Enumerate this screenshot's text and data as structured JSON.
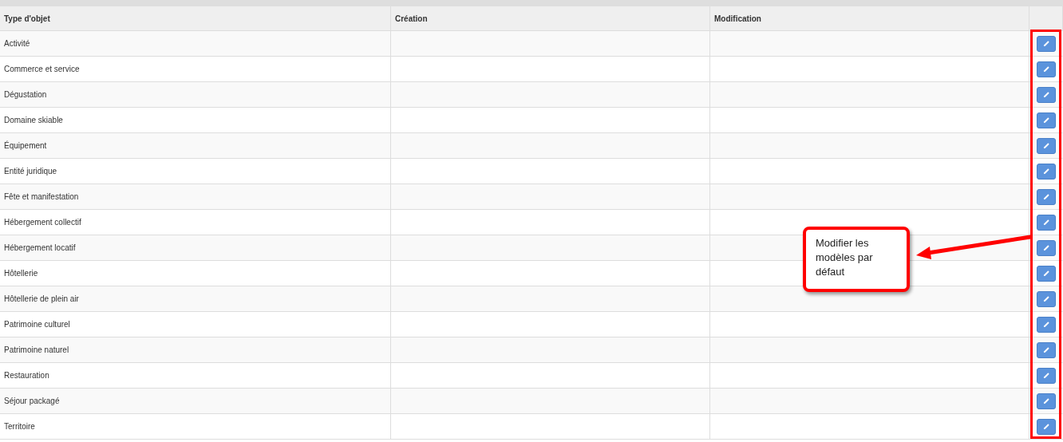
{
  "table": {
    "columns": [
      "Type d'objet",
      "Création",
      "Modification"
    ],
    "rows": [
      {
        "type": "Activité"
      },
      {
        "type": "Commerce et service"
      },
      {
        "type": "Dégustation"
      },
      {
        "type": "Domaine skiable"
      },
      {
        "type": "Équipement"
      },
      {
        "type": "Entité juridique"
      },
      {
        "type": "Fête et manifestation"
      },
      {
        "type": "Hébergement collectif"
      },
      {
        "type": "Hébergement locatif"
      },
      {
        "type": "Hôtellerie"
      },
      {
        "type": "Hôtellerie de plein air"
      },
      {
        "type": "Patrimoine culturel"
      },
      {
        "type": "Patrimoine naturel"
      },
      {
        "type": "Restauration"
      },
      {
        "type": "Séjour packagé"
      },
      {
        "type": "Territoire"
      }
    ]
  },
  "callout": {
    "text": "Modifier les modèles par défaut"
  }
}
